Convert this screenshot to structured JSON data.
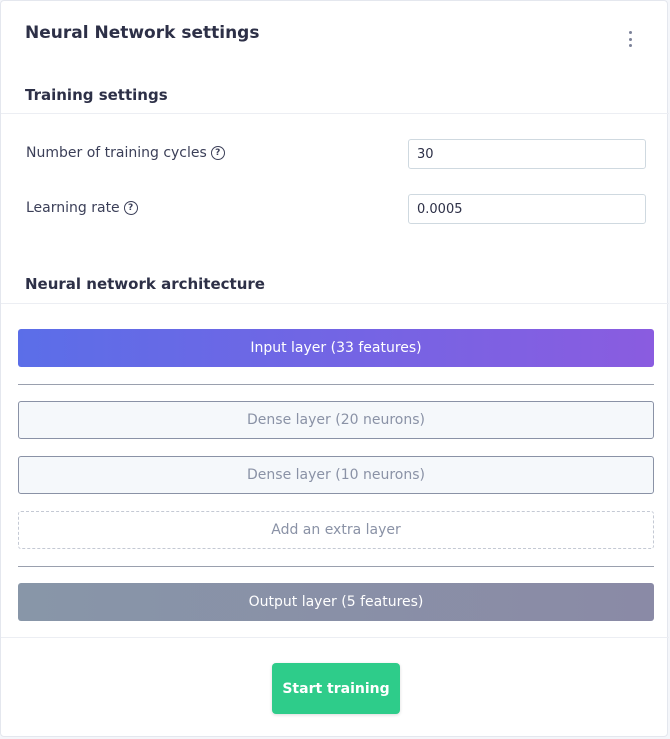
{
  "header": {
    "title": "Neural Network settings",
    "menu_icon": "kebab-menu-icon"
  },
  "training": {
    "section_title": "Training settings",
    "cycles_label": "Number of training cycles",
    "cycles_value": "30",
    "learning_rate_label": "Learning rate",
    "learning_rate_value": "0.0005",
    "help_icon": "question-circle-icon"
  },
  "architecture": {
    "section_title": "Neural network architecture",
    "input_layer": "Input layer (33 features)",
    "dense_layers": [
      "Dense layer (20 neurons)",
      "Dense layer (10 neurons)"
    ],
    "add_layer": "Add an extra layer",
    "output_layer": "Output layer (5 features)"
  },
  "actions": {
    "start_training": "Start training"
  },
  "colors": {
    "primary_gradient_start": "#5b6ee8",
    "primary_gradient_end": "#8a5ce0",
    "success": "#2ecc8a",
    "output_layer": "#8896a8"
  }
}
